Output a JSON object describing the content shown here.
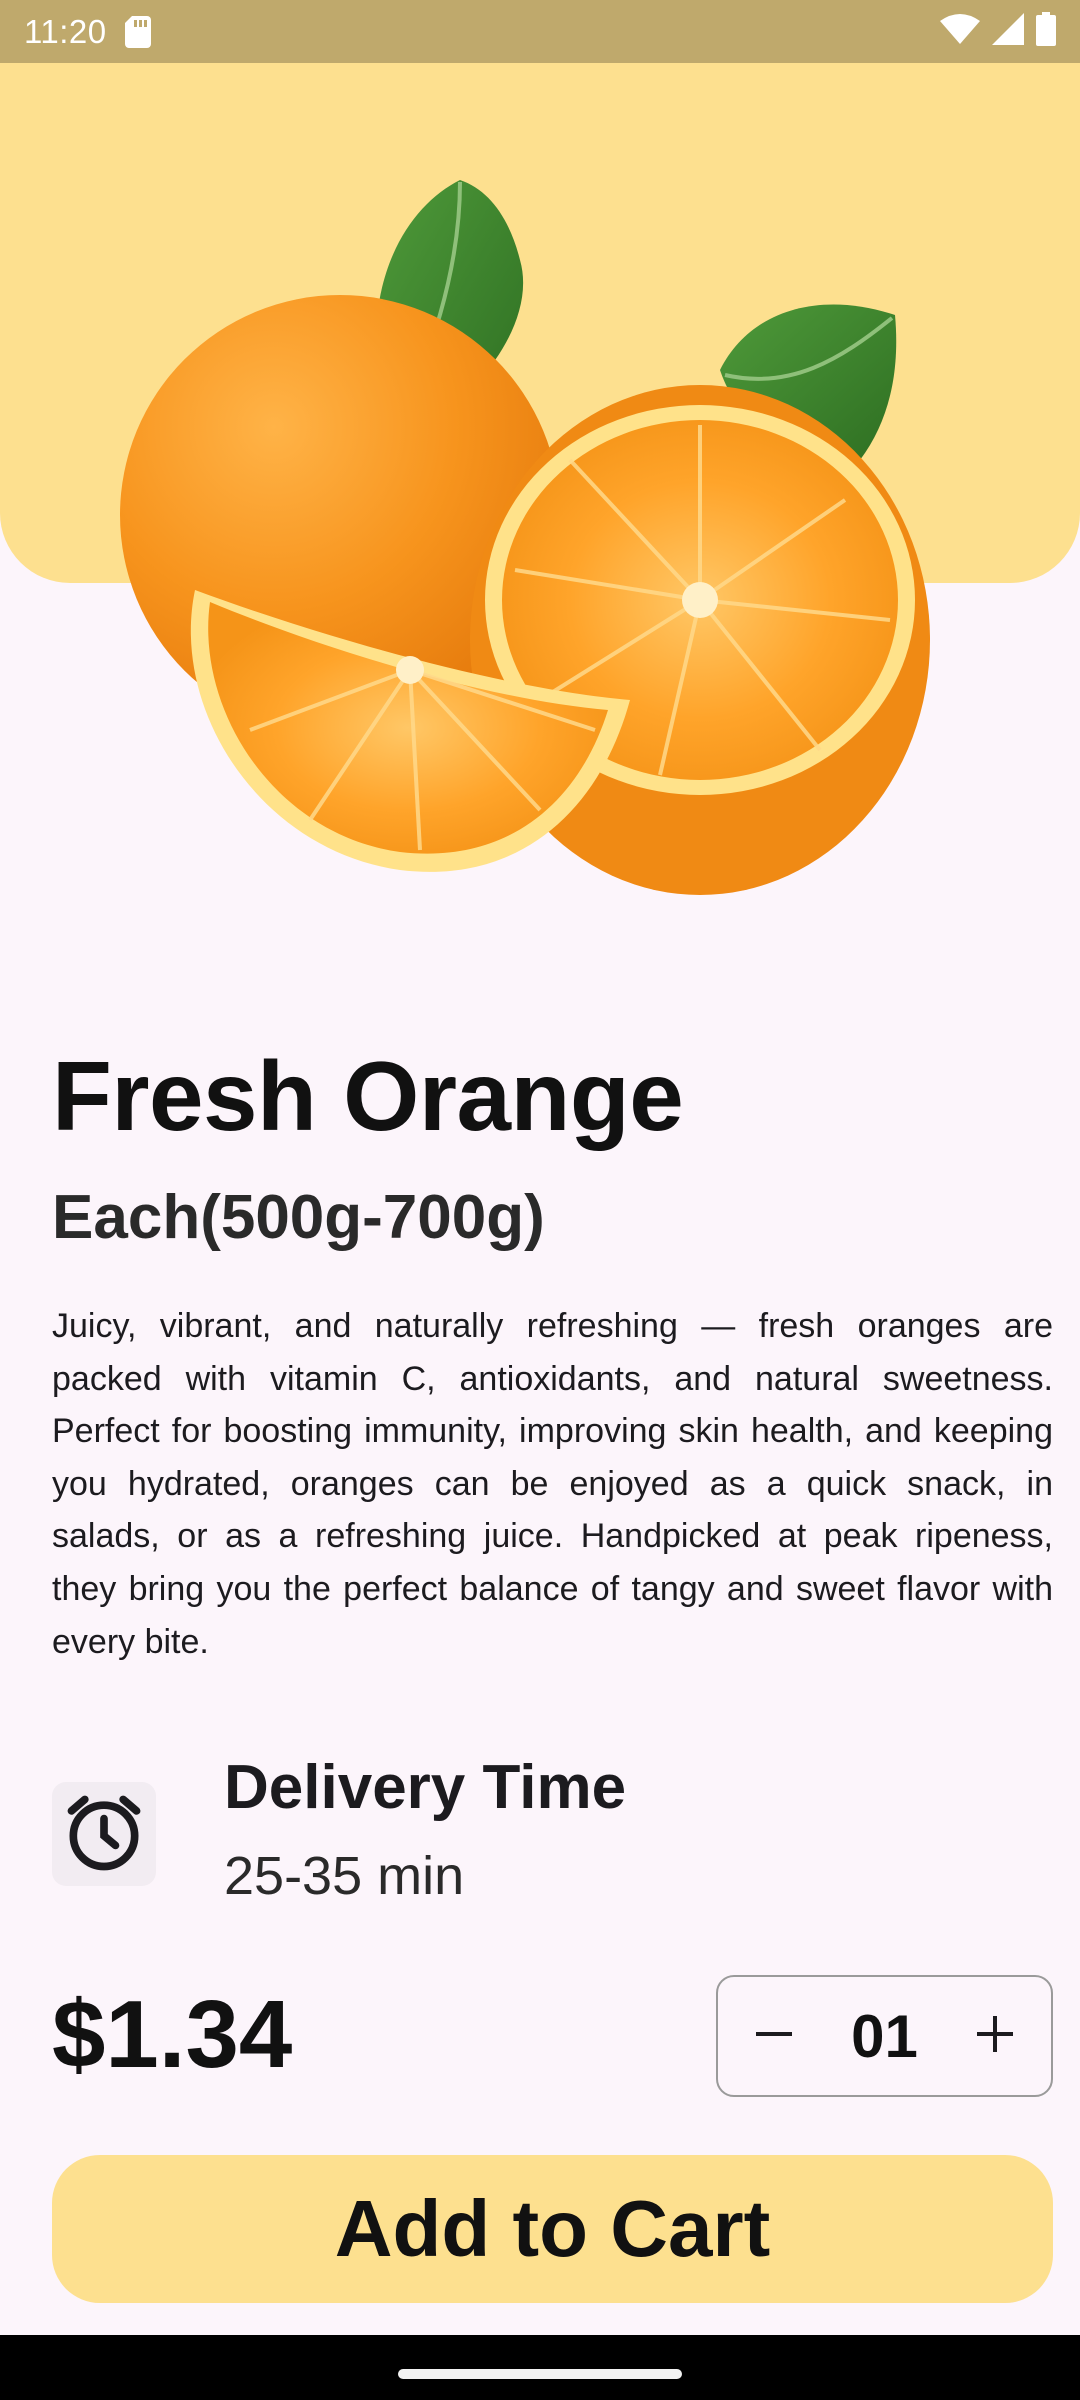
{
  "status_bar": {
    "time": "11:20",
    "icons": [
      "sd-card-icon",
      "wifi-icon",
      "signal-icon",
      "battery-icon"
    ]
  },
  "product": {
    "name": "Fresh Orange",
    "unit": "Each(500g-700g)",
    "description": "Juicy, vibrant, and naturally refreshing — fresh oranges are packed with vitamin C, antioxidants, and natural sweetness. Perfect for boosting immunity, improving skin health, and keeping you hydrated, oranges can be enjoyed as a quick snack, in salads, or as a refreshing juice. Handpicked at peak ripeness, they bring you the perfect balance of tangy and sweet flavor with every bite.",
    "image": "orange-image"
  },
  "delivery": {
    "icon": "alarm-clock-icon",
    "title": "Delivery Time",
    "value": "25-35 min"
  },
  "pricing": {
    "price": "$1.34",
    "quantity": "01",
    "decrement_icon": "minus-icon",
    "increment_icon": "plus-icon"
  },
  "actions": {
    "add_to_cart_label": "Add to Cart"
  },
  "colors": {
    "status_bar": "#bfa96c",
    "accent": "#fde08f",
    "background": "#fcf5fb",
    "text": "#1c1b1f"
  }
}
